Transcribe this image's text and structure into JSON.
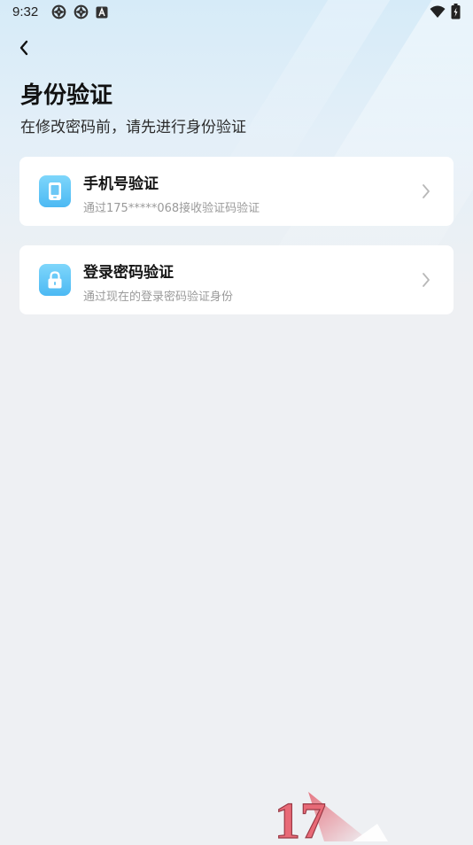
{
  "status_bar": {
    "time": "9:32",
    "left_icons": [
      "app-notification-icon",
      "app-notification-icon",
      "keyboard-a-icon"
    ],
    "right_icons": [
      "wifi-icon",
      "battery-charging-icon"
    ]
  },
  "header": {
    "back_icon": "chevron-left-icon",
    "title": "身份验证",
    "subtitle": "在修改密码前，请先进行身份验证"
  },
  "options": [
    {
      "icon": "phone-icon",
      "title": "手机号验证",
      "description": "通过175*****068接收验证码验证"
    },
    {
      "icon": "lock-icon",
      "title": "登录密码验证",
      "description": "通过现在的登录密码验证身份"
    }
  ],
  "colors": {
    "background": "#eef0f3",
    "card": "#ffffff",
    "icon_gradient_top": "#7ed6fb",
    "icon_gradient_bottom": "#4cb9f3",
    "title_text": "#111111",
    "secondary_text": "#9a9a9a"
  },
  "watermark": {
    "text": "17"
  }
}
